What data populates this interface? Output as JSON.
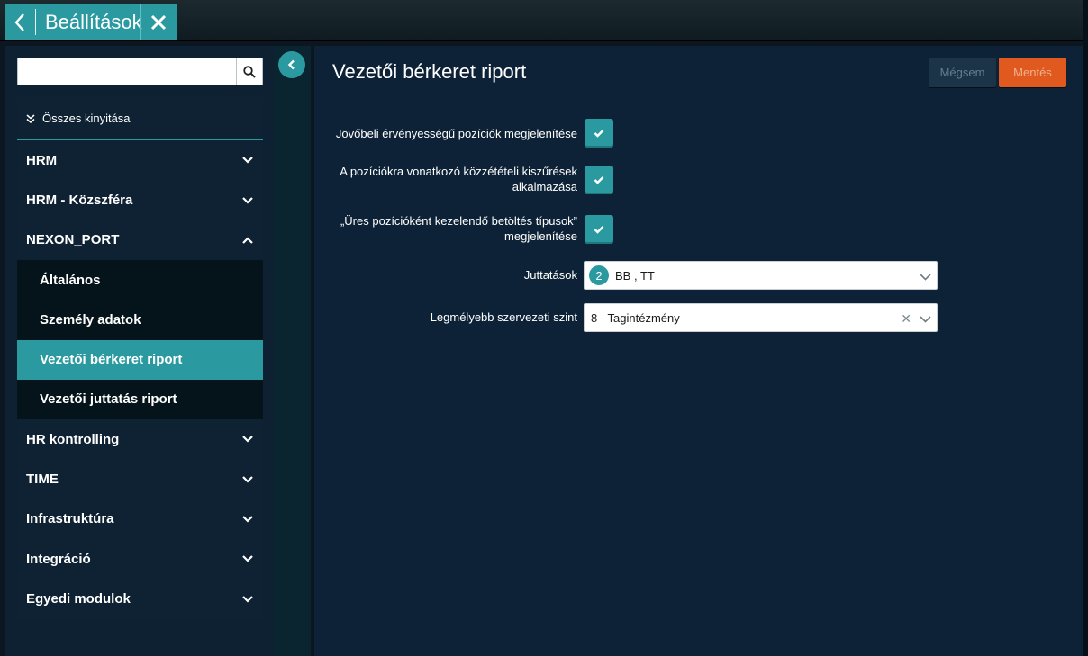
{
  "header": {
    "title": "Beállítások",
    "back_icon": "chevron-left-icon",
    "close_icon": "close-icon"
  },
  "sidebar": {
    "search": {
      "value": "",
      "placeholder": ""
    },
    "expand_all_label": "Összes kinyitása",
    "items": [
      {
        "label": "HRM",
        "expanded": false
      },
      {
        "label": "HRM - Közszféra",
        "expanded": false
      },
      {
        "label": "NEXON_PORT",
        "expanded": true
      },
      {
        "label": "HR kontrolling",
        "expanded": false
      },
      {
        "label": "TIME",
        "expanded": false
      },
      {
        "label": "Infrastruktúra",
        "expanded": false
      },
      {
        "label": "Integráció",
        "expanded": false
      },
      {
        "label": "Egyedi modulok",
        "expanded": false
      }
    ],
    "subitems": [
      {
        "label": "Általános",
        "active": false
      },
      {
        "label": "Személy adatok",
        "active": false
      },
      {
        "label": "Vezetői bérkeret riport",
        "active": true
      },
      {
        "label": "Vezetői juttatás riport",
        "active": false
      }
    ]
  },
  "main": {
    "title": "Vezetői bérkeret riport",
    "cancel_label": "Mégsem",
    "save_label": "Mentés",
    "options": [
      {
        "label": "Jövőbeli érvényességű pozíciók megjelenítése",
        "checked": true
      },
      {
        "label_line1": "A pozíciókra vonatkozó közzétételi kiszűrések",
        "label_line2": "alkalmazása",
        "checked": true
      },
      {
        "label_line1": "„Üres pozícióként kezelendő betöltés típusok”",
        "label_line2": "megjelenítése",
        "checked": true
      }
    ],
    "benefits": {
      "label": "Juttatások",
      "count": "2",
      "value": "BB , TT"
    },
    "org_level": {
      "label": "Legmélyebb szervezeti szint",
      "value": "8 - Tagintézmény"
    }
  },
  "colors": {
    "accent": "#2a9aa0",
    "save": "#e05a1f",
    "panel": "#0d2236",
    "sidebar": "#0f2233"
  }
}
